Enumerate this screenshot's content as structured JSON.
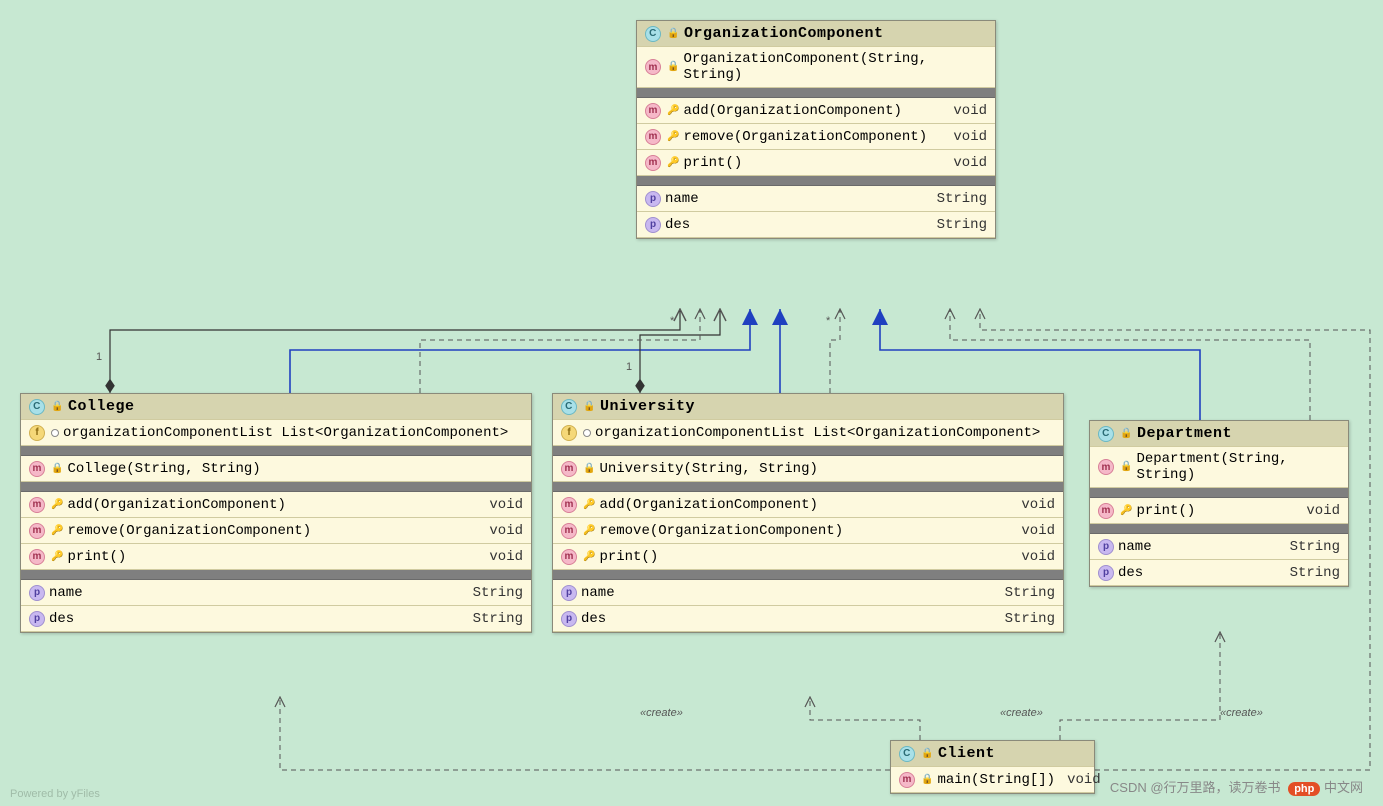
{
  "footer": "Powered by yFiles",
  "csdn": "CSDN @行万里路，读万卷书",
  "phpbadge": "php",
  "phpcn": "中文网",
  "classes": {
    "org": {
      "name": "OrganizationComponent",
      "ctor": "OrganizationComponent(String, String)",
      "m_add": "add(OrganizationComponent)",
      "m_add_t": "void",
      "m_rem": "remove(OrganizationComponent)",
      "m_rem_t": "void",
      "m_print": "print()",
      "m_print_t": "void",
      "p_name": "name",
      "p_name_t": "String",
      "p_des": "des",
      "p_des_t": "String"
    },
    "college": {
      "name": "College",
      "f_list": "organizationComponentList List<OrganizationComponent>",
      "ctor": "College(String, String)",
      "m_add": "add(OrganizationComponent)",
      "m_add_t": "void",
      "m_rem": "remove(OrganizationComponent)",
      "m_rem_t": "void",
      "m_print": "print()",
      "m_print_t": "void",
      "p_name": "name",
      "p_name_t": "String",
      "p_des": "des",
      "p_des_t": "String"
    },
    "university": {
      "name": "University",
      "f_list": "organizationComponentList List<OrganizationComponent>",
      "ctor": "University(String, String)",
      "m_add": "add(OrganizationComponent)",
      "m_add_t": "void",
      "m_rem": "remove(OrganizationComponent)",
      "m_rem_t": "void",
      "m_print": "print()",
      "m_print_t": "void",
      "p_name": "name",
      "p_name_t": "String",
      "p_des": "des",
      "p_des_t": "String"
    },
    "department": {
      "name": "Department",
      "ctor": "Department(String, String)",
      "m_print": "print()",
      "m_print_t": "void",
      "p_name": "name",
      "p_name_t": "String",
      "p_des": "des",
      "p_des_t": "String"
    },
    "client": {
      "name": "Client",
      "m_main": "main(String[])",
      "m_main_t": "void"
    }
  },
  "labels": {
    "create": "«create»",
    "one": "1",
    "star": "*"
  }
}
